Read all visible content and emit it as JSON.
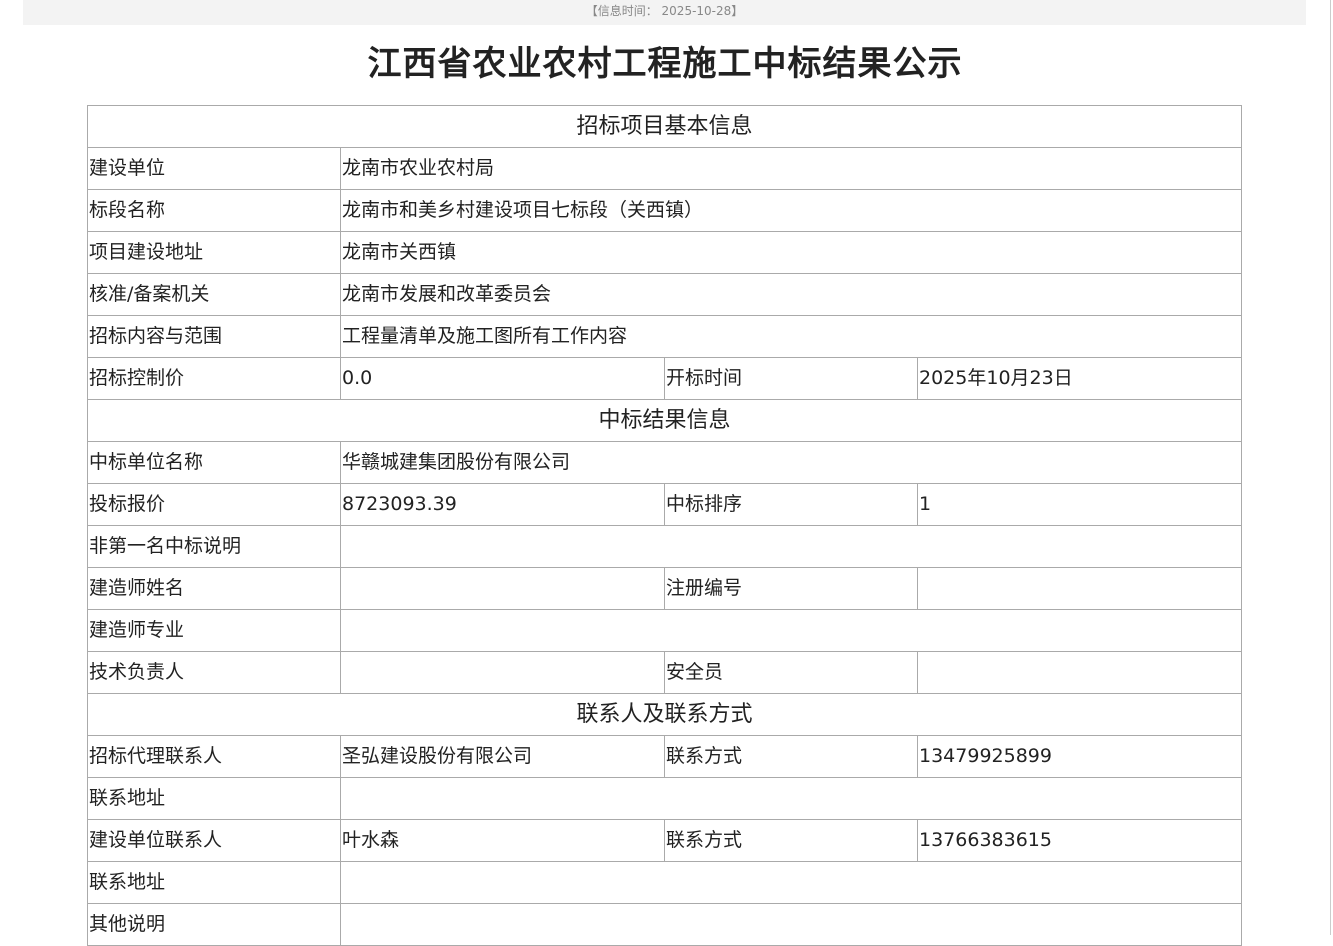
{
  "header": {
    "info_time": "【信息时间：  2025-10-28】",
    "title": "江西省农业农村工程施工中标结果公示"
  },
  "sections": {
    "basic": "招标项目基本信息",
    "result": "中标结果信息",
    "contact": "联系人及联系方式"
  },
  "basic": {
    "builder": {
      "label": "建设单位",
      "value": "龙南市农业农村局"
    },
    "section_name": {
      "label": "标段名称",
      "value": "龙南市和美乡村建设项目七标段（关西镇）"
    },
    "address": {
      "label": "项目建设地址",
      "value": "龙南市关西镇"
    },
    "approval": {
      "label": "核准/备案机关",
      "value": "龙南市发展和改革委员会"
    },
    "scope": {
      "label": "招标内容与范围",
      "value": "工程量清单及施工图所有工作内容"
    },
    "control_price": {
      "label": "招标控制价",
      "value": "0.0"
    },
    "open_time": {
      "label": "开标时间",
      "value": "2025年10月23日"
    }
  },
  "result": {
    "winner": {
      "label": "中标单位名称",
      "value": "华赣城建集团股份有限公司"
    },
    "bid_price": {
      "label": "投标报价",
      "value": "8723093.39"
    },
    "rank": {
      "label": "中标排序",
      "value": "1"
    },
    "non_first_note": {
      "label": "非第一名中标说明",
      "value": ""
    },
    "builder_name": {
      "label": "建造师姓名",
      "value": ""
    },
    "reg_no": {
      "label": "注册编号",
      "value": ""
    },
    "builder_major": {
      "label": "建造师专业",
      "value": ""
    },
    "tech_lead": {
      "label": "技术负责人",
      "value": ""
    },
    "safety_officer": {
      "label": "安全员",
      "value": ""
    }
  },
  "contact": {
    "agent": {
      "label": "招标代理联系人",
      "value": "圣弘建设股份有限公司"
    },
    "agent_phone": {
      "label": "联系方式",
      "value": "13479925899"
    },
    "agent_address": {
      "label": "联系地址",
      "value": ""
    },
    "owner": {
      "label": "建设单位联系人",
      "value": "叶水森"
    },
    "owner_phone": {
      "label": "联系方式",
      "value": "13766383615"
    },
    "owner_address": {
      "label": "联系地址",
      "value": ""
    },
    "other": {
      "label": "其他说明",
      "value": ""
    }
  }
}
